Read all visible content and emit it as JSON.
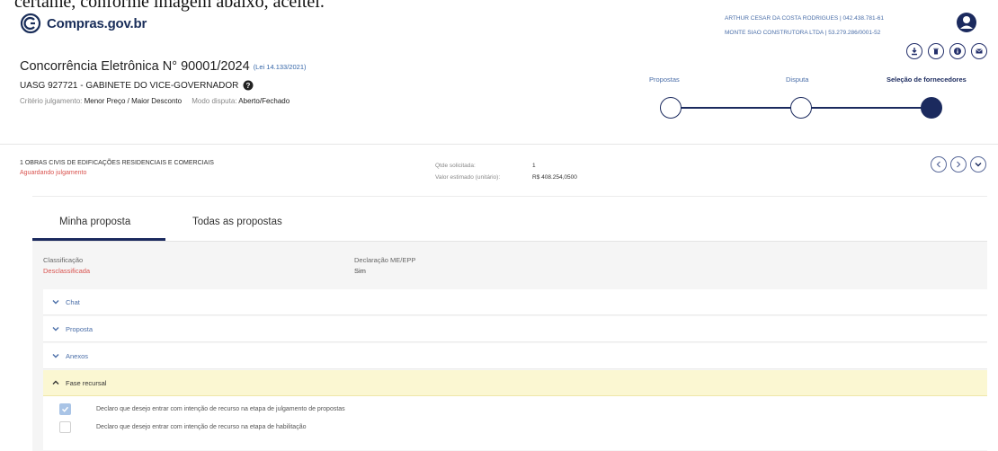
{
  "cropped_text": "certame, conforme imagem abaixo, aceitei.",
  "header": {
    "logo_text": "Compras.gov.br",
    "user_line1": "ARTHUR CESAR DA COSTA RODRIGUES | 042.438.781-61",
    "user_line2": "MONTE SIAO CONSTRUTORA LTDA | 53.279.286/0001-52"
  },
  "process": {
    "title": "Concorrência Eletrônica N° 90001/2024",
    "law": "(Lei 14.133/2021)",
    "uasg": "UASG 927721 - GABINETE DO VICE-GOVERNADOR",
    "criterio_label": "Critério julgamento:",
    "criterio_value": "Menor Preço / Maior Desconto",
    "modo_label": "Modo disputa:",
    "modo_value": "Aberto/Fechado"
  },
  "steps": [
    {
      "label": "Propostas",
      "state": "empty"
    },
    {
      "label": "Disputa",
      "state": "empty"
    },
    {
      "label": "Seleção de fornecedores",
      "state": "current"
    }
  ],
  "item": {
    "title": "1  OBRAS CIVIS DE EDIFICAÇÕES RESIDENCIAIS E COMERCIAIS",
    "status": "Aguardando julgamento",
    "qty_label": "Qtde solicitada:",
    "qty_value": "1",
    "unit_label": "Valor estimado (unitário):",
    "unit_value": "R$ 408.254,0500"
  },
  "tabs": [
    {
      "label": "Minha proposta",
      "active": true
    },
    {
      "label": "Todas as propostas",
      "active": false
    }
  ],
  "proposta": {
    "classificacao_label": "Classificação",
    "classificacao_value": "Desclassificada",
    "declaracao_label": "Declaração ME/EPP",
    "declaracao_value": "Sim"
  },
  "accordions": [
    {
      "label": "Chat",
      "open": false
    },
    {
      "label": "Proposta",
      "open": false
    },
    {
      "label": "Anexos",
      "open": false
    },
    {
      "label": "Fase recursal",
      "open": true
    }
  ],
  "recurso": [
    {
      "label": "Declaro que desejo entrar com intenção de recurso na etapa de julgamento de propostas",
      "checked": true
    },
    {
      "label": "Declaro que desejo entrar com intenção de recurso na etapa de habilitação",
      "checked": false
    }
  ],
  "colors": {
    "primary": "#1b2a5e",
    "link": "#4a6ea8",
    "danger": "#d9534f",
    "highlight": "#fbf7d2"
  }
}
